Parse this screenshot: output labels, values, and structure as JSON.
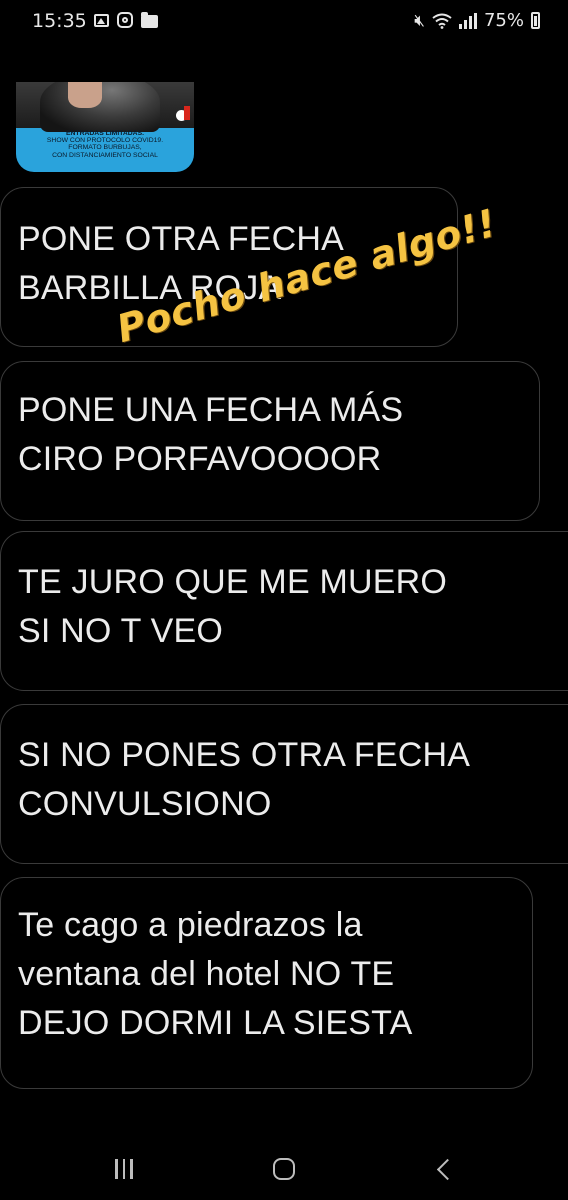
{
  "status_bar": {
    "time": "15:35",
    "battery_percent": "75%",
    "left_icons": [
      "gallery-icon",
      "instagram-icon",
      "folder-icon"
    ],
    "right_icons": [
      "mute-icon",
      "wifi-icon",
      "signal-icon",
      "battery-icon"
    ]
  },
  "story_preview": {
    "caption_title": "ENTRADAS LIMITADAS.",
    "caption_lines": [
      "SHOW CON PROTOCOLO COVID19.",
      "FORMATO BURBUJAS,",
      "CON DISTANCIAMIENTO SOCIAL"
    ]
  },
  "messages": [
    {
      "text": "PONE OTRA FECHA\nBARBILLA ROJA"
    },
    {
      "text": "PONE UNA FECHA MÁS\nCIRO PORFAVOOOOR"
    },
    {
      "text": "TE JURO QUE ME MUERO\nSI NO T VEO"
    },
    {
      "text": "SI NO PONES OTRA FECHA\nCONVULSIONO"
    },
    {
      "text": "Te cago a piedrazos la\nventana del hotel NO TE\nDEJO DORMI LA SIESTA"
    }
  ],
  "sticker": {
    "text": "Pocho hace algo!!",
    "color": "#f5c342"
  },
  "nav_bar": {
    "buttons": [
      "recent-apps-icon",
      "home-icon",
      "back-icon"
    ]
  },
  "colors": {
    "background": "#000000",
    "bubble_border": "#3a3a3a",
    "text": "#ececec",
    "story_blue": "#2aa3dc"
  }
}
